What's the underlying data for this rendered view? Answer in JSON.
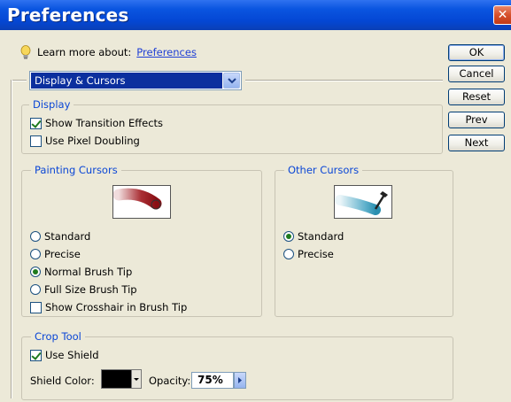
{
  "window": {
    "title": "Preferences",
    "close_glyph": "✕"
  },
  "learn_more": {
    "label": "Learn more about:",
    "link": "Preferences",
    "icon": "lightbulb-icon"
  },
  "section_select": {
    "value": "Display & Cursors"
  },
  "buttons": {
    "ok": "OK",
    "cancel": "Cancel",
    "reset": "Reset",
    "prev": "Prev",
    "next": "Next"
  },
  "display": {
    "title": "Display",
    "show_transition": {
      "label": "Show Transition Effects",
      "checked": true
    },
    "pixel_doubling": {
      "label": "Use Pixel Doubling",
      "checked": false
    }
  },
  "painting_cursors": {
    "title": "Painting Cursors",
    "options": [
      "Standard",
      "Precise",
      "Normal Brush Tip",
      "Full Size Brush Tip"
    ],
    "selected": "Normal Brush Tip",
    "crosshair": {
      "label": "Show Crosshair in Brush Tip",
      "checked": false
    },
    "preview_color": "#a0181e"
  },
  "other_cursors": {
    "title": "Other Cursors",
    "options": [
      "Standard",
      "Precise"
    ],
    "selected": "Standard",
    "preview_color": "#3a9fc0"
  },
  "crop_tool": {
    "title": "Crop Tool",
    "use_shield": {
      "label": "Use Shield",
      "checked": true
    },
    "shield_color_label": "Shield Color:",
    "shield_color": "#000000",
    "opacity_label": "Opacity:",
    "opacity_value": "75%"
  }
}
